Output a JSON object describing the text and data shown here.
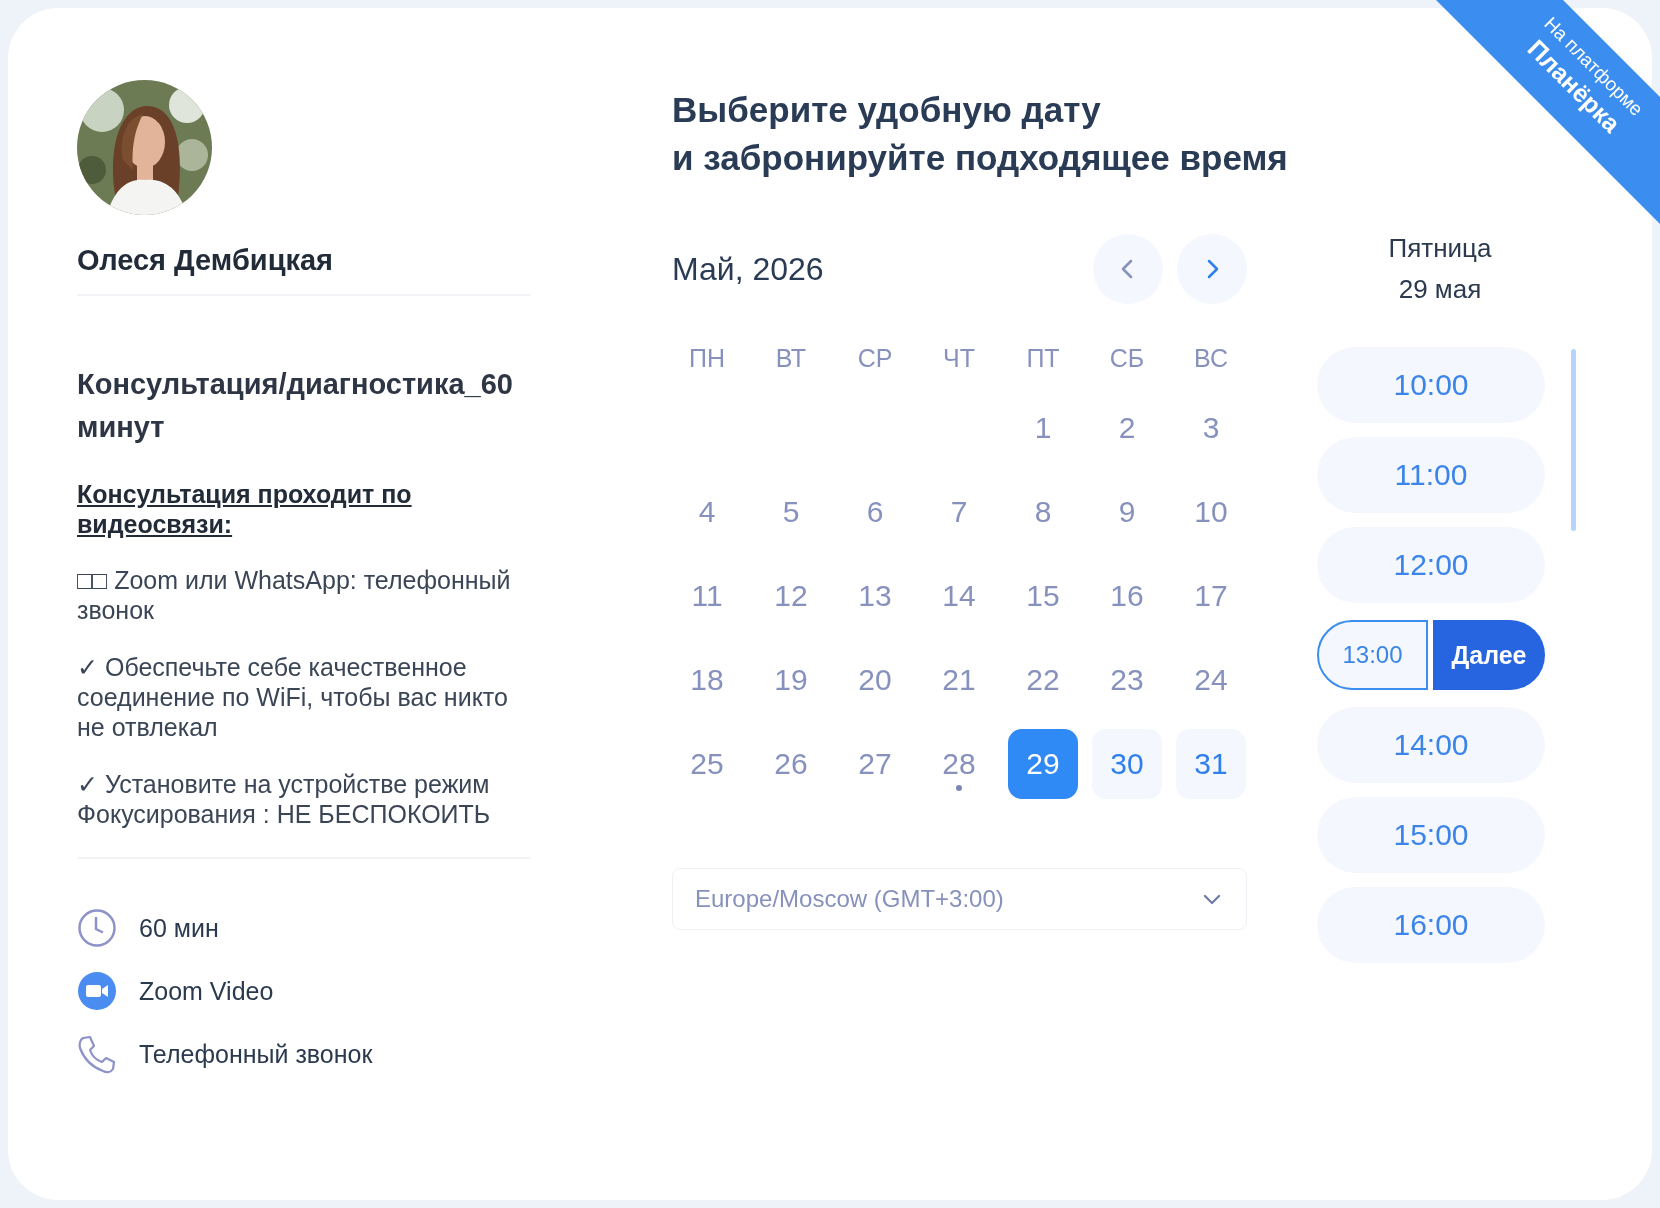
{
  "host": {
    "name": "Олеся Дембицкая"
  },
  "event": {
    "title": "Консультация/диагностика_60 минут",
    "description_heading": "Консультация проходит по видеосвязи:",
    "notes": [
      "□□ Zoom или WhatsApp: телефонный звонок",
      "✓ Обеспечьте себе качественное соединение по WiFi, чтобы вас никто не отвлекал",
      "✓ Установите на устройстве режим Фокусирования : НЕ БЕСПОКОИТЬ"
    ]
  },
  "details": [
    {
      "kind": "duration",
      "label": "60 мин"
    },
    {
      "kind": "zoom",
      "label": "Zoom Video"
    },
    {
      "kind": "phone",
      "label": "Телефонный звонок"
    }
  ],
  "heading": [
    "Выберите удобную дату",
    "и забронируйте подходящее время"
  ],
  "calendar": {
    "month": "Май, 2026",
    "nav": [
      {
        "kind": "prev",
        "disabled": true
      },
      {
        "kind": "next",
        "disabled": false
      }
    ],
    "weekdays": [
      "ПН",
      "ВТ",
      "СР",
      "ЧТ",
      "ПТ",
      "СБ",
      "ВС"
    ],
    "weeks": [
      [
        {
          "kind": "blank"
        },
        {
          "kind": "blank"
        },
        {
          "kind": "blank"
        },
        {
          "kind": "blank"
        },
        {
          "label": "1",
          "available": false,
          "selected": false,
          "today": false
        },
        {
          "label": "2",
          "available": false,
          "selected": false,
          "today": false
        },
        {
          "label": "3",
          "available": false,
          "selected": false,
          "today": false
        }
      ],
      [
        {
          "label": "4",
          "available": false,
          "selected": false,
          "today": false
        },
        {
          "label": "5",
          "available": false,
          "selected": false,
          "today": false
        },
        {
          "label": "6",
          "available": false,
          "selected": false,
          "today": false
        },
        {
          "label": "7",
          "available": false,
          "selected": false,
          "today": false
        },
        {
          "label": "8",
          "available": false,
          "selected": false,
          "today": false
        },
        {
          "label": "9",
          "available": false,
          "selected": false,
          "today": false
        },
        {
          "label": "10",
          "available": false,
          "selected": false,
          "today": false
        }
      ],
      [
        {
          "label": "11",
          "available": false,
          "selected": false,
          "today": false
        },
        {
          "label": "12",
          "available": false,
          "selected": false,
          "today": false
        },
        {
          "label": "13",
          "available": false,
          "selected": false,
          "today": false
        },
        {
          "label": "14",
          "available": false,
          "selected": false,
          "today": false
        },
        {
          "label": "15",
          "available": false,
          "selected": false,
          "today": false
        },
        {
          "label": "16",
          "available": false,
          "selected": false,
          "today": false
        },
        {
          "label": "17",
          "available": false,
          "selected": false,
          "today": false
        }
      ],
      [
        {
          "label": "18",
          "available": false,
          "selected": false,
          "today": false
        },
        {
          "label": "19",
          "available": false,
          "selected": false,
          "today": false
        },
        {
          "label": "20",
          "available": false,
          "selected": false,
          "today": false
        },
        {
          "label": "21",
          "available": false,
          "selected": false,
          "today": false
        },
        {
          "label": "22",
          "available": false,
          "selected": false,
          "today": false
        },
        {
          "label": "23",
          "available": false,
          "selected": false,
          "today": false
        },
        {
          "label": "24",
          "available": false,
          "selected": false,
          "today": false
        }
      ],
      [
        {
          "label": "25",
          "available": false,
          "selected": false,
          "today": false
        },
        {
          "label": "26",
          "available": false,
          "selected": false,
          "today": false
        },
        {
          "label": "27",
          "available": false,
          "selected": false,
          "today": false
        },
        {
          "label": "28",
          "available": false,
          "selected": false,
          "today": true
        },
        {
          "label": "29",
          "available": true,
          "selected": true,
          "today": false
        },
        {
          "label": "30",
          "available": true,
          "selected": false,
          "today": false
        },
        {
          "label": "31",
          "available": true,
          "selected": false,
          "today": false
        }
      ]
    ],
    "timezone": {
      "value": "Europe/Moscow (GMT+3:00)"
    }
  },
  "day_heading": [
    "Пятница",
    "29 мая"
  ],
  "slots": [
    {
      "time": "10:00",
      "selected": false
    },
    {
      "time": "11:00",
      "selected": false
    },
    {
      "time": "12:00",
      "selected": false
    },
    {
      "time": "13:00",
      "selected": true,
      "next_button": "Далее"
    },
    {
      "time": "14:00",
      "selected": false
    },
    {
      "time": "15:00",
      "selected": false
    },
    {
      "time": "16:00",
      "selected": false
    }
  ],
  "badge": {
    "line1": "На платформе",
    "line2": "Планёрка"
  }
}
